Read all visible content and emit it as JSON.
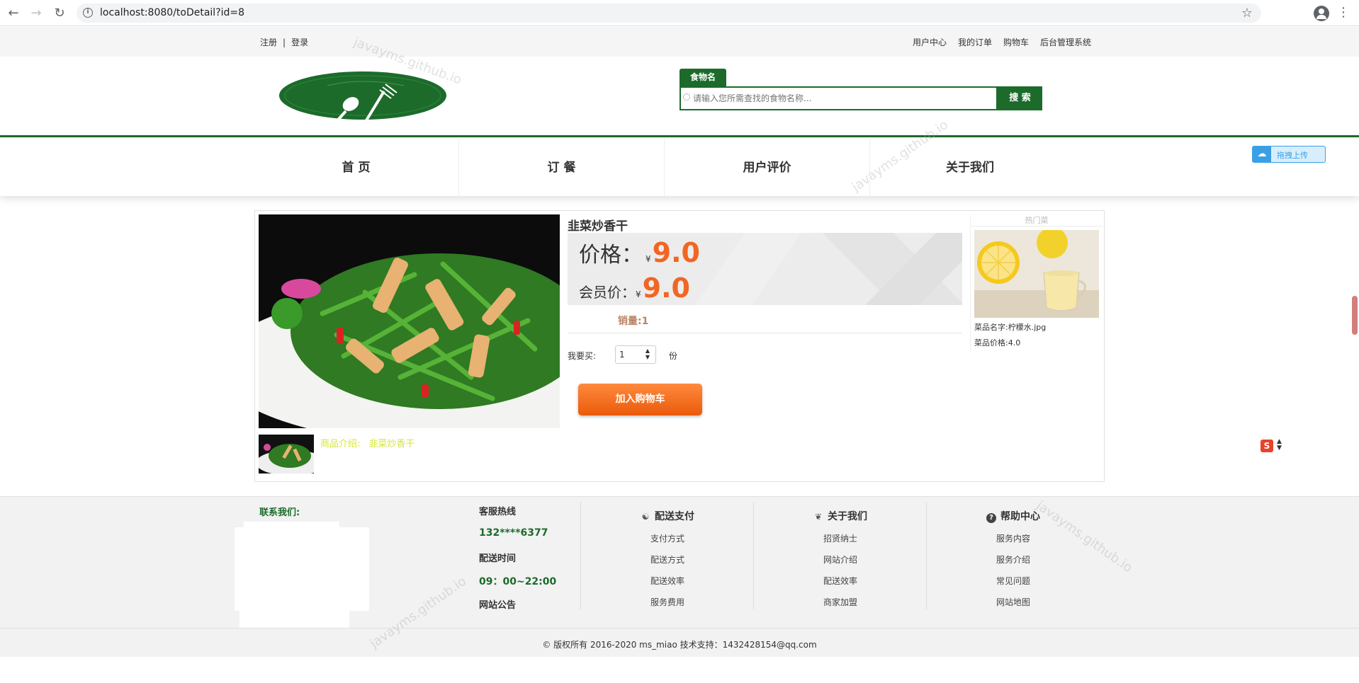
{
  "browser": {
    "url": "localhost:8080/toDetail?id=8"
  },
  "topbar": {
    "register": "注册",
    "divider": "|",
    "login": "登录",
    "links": [
      "用户中心",
      "我的订单",
      "购物车",
      "后台管理系统"
    ]
  },
  "search": {
    "tab": "食物名",
    "placeholder": "请输入您所需查找的食物名称...",
    "button": "搜 索"
  },
  "nav": [
    "首 页",
    "订 餐",
    "用户评价",
    "关于我们"
  ],
  "upload": {
    "label": "拖拽上传"
  },
  "product": {
    "name": "韭菜炒香干",
    "price_label": "价格：",
    "price_currency": "¥",
    "price": "9.0",
    "member_label": "会员价：",
    "member_currency": "¥",
    "member_price": "9.0",
    "sales": "销量:1",
    "qty_label": "我要买:",
    "qty_value": "1",
    "qty_unit": "份",
    "cart_button": "加入购物车",
    "intro_label": "商品介绍:",
    "intro_text": "韭菜炒香干"
  },
  "hot": {
    "title": "热门菜",
    "name": "菜品名字:柠檬水.jpg",
    "price": "菜品价格:4.0"
  },
  "footer": {
    "contact": "联系我们:",
    "hotline_label": "客服热线",
    "hotline": "132****6377",
    "delivery_time_label": "配送时间",
    "delivery_time": "09：00~22:00",
    "notice": "网站公告",
    "columns": [
      {
        "title": "配送支付",
        "icon": "bike-icon",
        "links": [
          "支付方式",
          "配送方式",
          "配送效率",
          "服务费用"
        ]
      },
      {
        "title": "关于我们",
        "icon": "leaf-icon",
        "links": [
          "招贤纳士",
          "网站介绍",
          "配送效率",
          "商家加盟"
        ]
      },
      {
        "title": "帮助中心",
        "icon": "question-icon",
        "links": [
          "服务内容",
          "服务介绍",
          "常见问题",
          "网站地图"
        ]
      }
    ],
    "copyright": "© 版权所有 2016-2020   ms_miao 技术支持：1432428154@qq.com"
  },
  "watermark": "javayms.github.io",
  "colors": {
    "brand_green": "#1c6b2b",
    "price_orange": "#f26522",
    "button_orange": "#ea5a0b"
  }
}
